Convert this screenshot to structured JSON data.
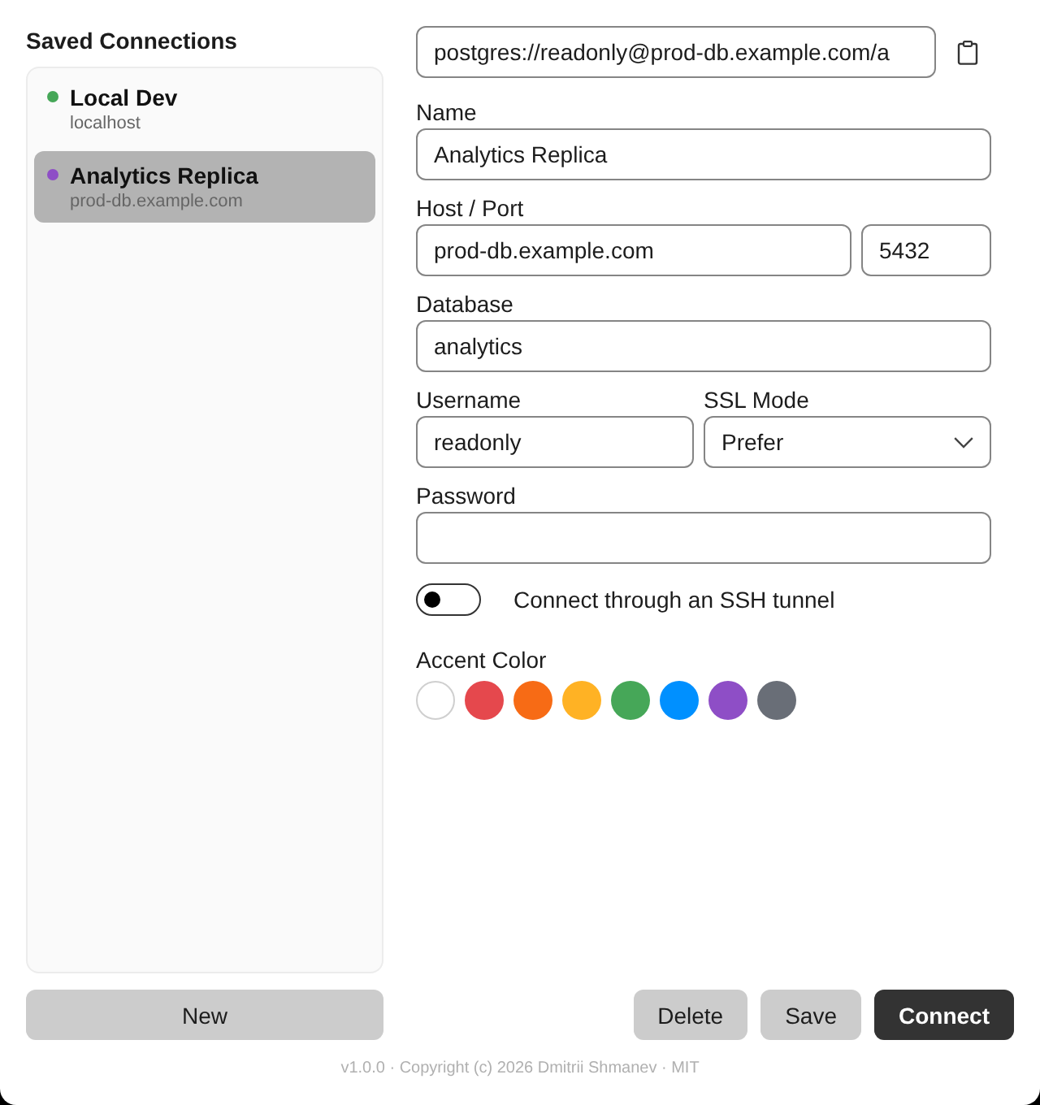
{
  "sidebar": {
    "title": "Saved Connections",
    "connections": [
      {
        "name": "Local Dev",
        "host": "localhost",
        "color": "#46a758",
        "selected": false
      },
      {
        "name": "Analytics Replica",
        "host": "prod-db.example.com",
        "color": "#8e4ec6",
        "selected": true
      }
    ],
    "new_button": "New"
  },
  "form": {
    "url_field": {
      "value": "postgres://readonly@prod-db.example.com/a"
    },
    "name": {
      "label": "Name",
      "value": "Analytics Replica"
    },
    "host_port": {
      "label": "Host / Port",
      "host": "prod-db.example.com",
      "port": "5432"
    },
    "database": {
      "label": "Database",
      "value": "analytics"
    },
    "username": {
      "label": "Username",
      "value": "readonly"
    },
    "ssl_mode": {
      "label": "SSL Mode",
      "value": "Prefer"
    },
    "password": {
      "label": "Password"
    },
    "ssh_tunnel": {
      "label": "Connect through an SSH tunnel",
      "on": false
    },
    "accent_color": {
      "label": "Accent Color",
      "swatches": [
        {
          "color": "#ffffff"
        },
        {
          "color": "#e5484d"
        },
        {
          "color": "#f76b15"
        },
        {
          "color": "#ffb224"
        },
        {
          "color": "#46a758"
        },
        {
          "color": "#0090ff"
        },
        {
          "color": "#8e4ec6"
        },
        {
          "color": "#696e77"
        }
      ]
    }
  },
  "actions": [
    {
      "label": "Delete",
      "kind": "secondary"
    },
    {
      "label": "Save",
      "kind": "secondary"
    },
    {
      "label": "Connect",
      "kind": "primary"
    }
  ],
  "footer": "v1.0.0 · Copyright (c) 2026 Dmitrii Shmanev · MIT"
}
